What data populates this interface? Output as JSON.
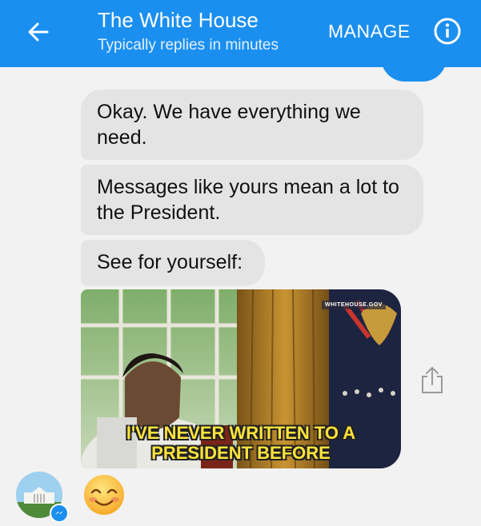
{
  "header": {
    "back_icon": "arrow-left-icon",
    "title": "The White House",
    "subtitle": "Typically replies in minutes",
    "manage_label": "MANAGE",
    "info_icon": "info-icon",
    "background_color": "#1a8ff0"
  },
  "messages": [
    {
      "text": "Okay. We have everything we need."
    },
    {
      "text": "Messages like yours mean a lot to the President."
    },
    {
      "text": "See for yourself:"
    }
  ],
  "gif": {
    "watermark": "WHITEHOUSE.GOV",
    "caption_line1": "I'VE NEVER WRITTEN TO A",
    "caption_line2": "PRESIDENT BEFORE"
  },
  "share_icon": "share-icon",
  "avatar_icon": "white-house-avatar",
  "messenger_badge_icon": "messenger-icon",
  "emoji_icon": "smiling-face-emoji"
}
